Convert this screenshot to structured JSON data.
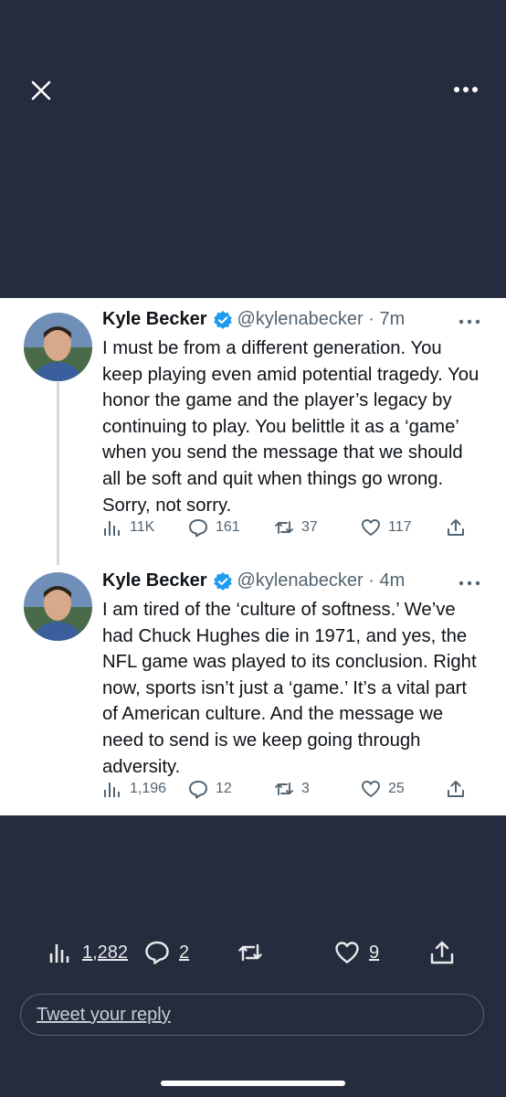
{
  "topbar": {
    "close_icon": "close-icon",
    "more_icon": "more-horizontal-icon"
  },
  "tweets": [
    {
      "name": "Kyle Becker",
      "handle": "@kylenabecker",
      "separator": " · ",
      "time": "7m",
      "text": "I must be from a different generation. You keep playing even amid potential tragedy. You honor the game and the player’s legacy by continuing to play. You belittle it as a ‘game’ when you send the message that we should all be soft and quit when things go wrong. Sorry, not sorry.",
      "views": "11K",
      "replies": "161",
      "retweets": "37",
      "likes": "117"
    },
    {
      "name": "Kyle Becker",
      "handle": "@kylenabecker",
      "separator": " · ",
      "time": "4m",
      "text": "I am tired of the ‘culture of softness.’ We’ve had Chuck Hughes die in 1971, and yes, the NFL game was played to its conclusion. Right now, sports isn’t just a ‘game.’ It’s a vital part of American culture. And the message we need to send is we keep going through adversity.",
      "views": "1,196",
      "replies": "12",
      "retweets": "3",
      "likes": "25"
    }
  ],
  "bottom_bar": {
    "views": "1,282",
    "replies": "2",
    "likes": "9"
  },
  "reply": {
    "placeholder": "Tweet your reply"
  },
  "colors": {
    "background": "#252c3d",
    "verified": "#1d9bf0",
    "text": "#0f1419",
    "secondary": "#536471"
  }
}
